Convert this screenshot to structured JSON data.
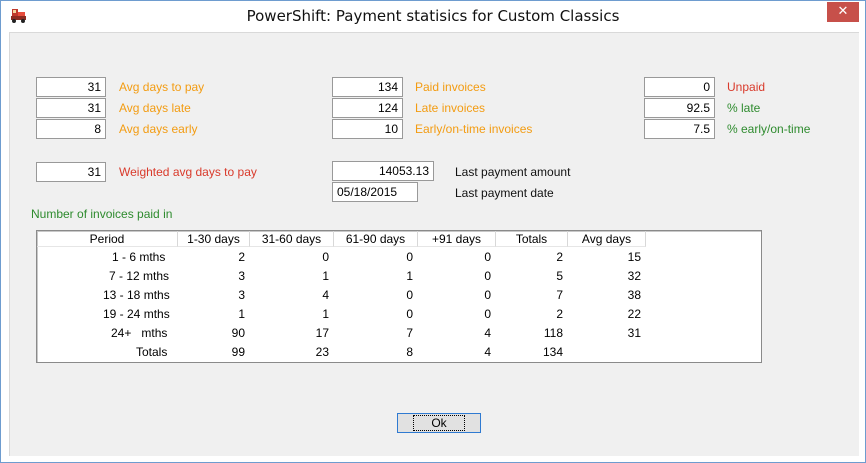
{
  "window": {
    "title": "PowerShift: Payment statisics for Custom Classics",
    "close_glyph": "✕",
    "icon": "powershift-truck-icon"
  },
  "stats_left": [
    {
      "value": "31",
      "label": "Avg days to pay",
      "color": "#f39c12"
    },
    {
      "value": "31",
      "label": "Avg days late",
      "color": "#f39c12"
    },
    {
      "value": "8",
      "label": "Avg days early",
      "color": "#f39c12"
    }
  ],
  "stats_mid": [
    {
      "value": "134",
      "label": "Paid invoices",
      "color": "#f39c12"
    },
    {
      "value": "124",
      "label": "Late invoices",
      "color": "#f39c12"
    },
    {
      "value": "10",
      "label": "Early/on-time invoices",
      "color": "#f39c12"
    }
  ],
  "stats_right": [
    {
      "value": "0",
      "label": "Unpaid",
      "color": "#d93a2b"
    },
    {
      "value": "92.5",
      "label": "% late",
      "color": "#2e8b2e"
    },
    {
      "value": "7.5",
      "label": "% early/on-time",
      "color": "#2e8b2e"
    }
  ],
  "weighted": {
    "value": "31",
    "label": "Weighted avg days to pay"
  },
  "last_payment": {
    "amount": "14053.13",
    "amount_label": "Last payment amount",
    "date": "05/18/2015",
    "date_label": "Last payment date"
  },
  "grid": {
    "caption": "Number of invoices paid in",
    "columns": [
      "Period",
      "1-30 days",
      "31-60 days",
      "61-90 days",
      "+91 days",
      "Totals",
      "Avg days"
    ],
    "rows": [
      {
        "period": "1 - 6  mths",
        "c1": "2",
        "c2": "0",
        "c3": "0",
        "c4": "0",
        "total": "2",
        "avg": "15"
      },
      {
        "period": "7 - 12 mths",
        "c1": "3",
        "c2": "1",
        "c3": "1",
        "c4": "0",
        "total": "5",
        "avg": "32"
      },
      {
        "period": "13 - 18 mths",
        "c1": "3",
        "c2": "4",
        "c3": "0",
        "c4": "0",
        "total": "7",
        "avg": "38"
      },
      {
        "period": "19 - 24 mths",
        "c1": "1",
        "c2": "1",
        "c3": "0",
        "c4": "0",
        "total": "2",
        "avg": "22"
      },
      {
        "period": "24+   mths",
        "c1": "90",
        "c2": "17",
        "c3": "7",
        "c4": "4",
        "total": "118",
        "avg": "31"
      },
      {
        "period": "Totals",
        "c1": "99",
        "c2": "23",
        "c3": "8",
        "c4": "4",
        "total": "134",
        "avg": ""
      }
    ]
  },
  "ok_button": {
    "label": "Ok"
  }
}
